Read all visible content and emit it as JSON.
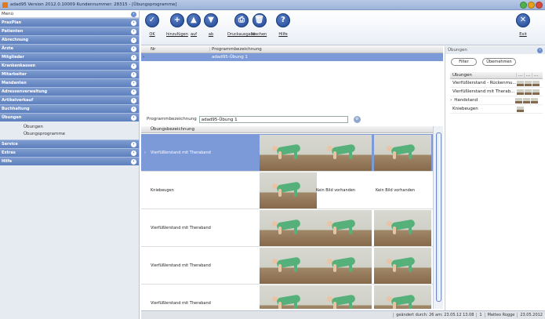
{
  "window": {
    "title": "adad95  Version 2012.0.10009  Kundennummer: 28315 - [Übungsprogramme]",
    "colors": {
      "minimize": "#4fb34a",
      "maximize": "#e3a21a",
      "close": "#d94a3a"
    }
  },
  "sidebar": {
    "header": "Menü",
    "items": [
      {
        "label": "PraxPlan"
      },
      {
        "label": "Patienten"
      },
      {
        "label": "Abrechnung"
      },
      {
        "label": "Ärzte"
      },
      {
        "label": "Mitglieder"
      },
      {
        "label": "Krankenkassen"
      },
      {
        "label": "Mitarbeiter"
      },
      {
        "label": "Mandanten"
      },
      {
        "label": "Adressenverwaltung"
      },
      {
        "label": "Artikelverkauf"
      },
      {
        "label": "Buchhaltung"
      },
      {
        "label": "Übungen"
      }
    ],
    "subitems": [
      "Übungen",
      "Übungsprogramme"
    ],
    "items2": [
      {
        "label": "Service"
      },
      {
        "label": "Extras"
      },
      {
        "label": "Hilfe"
      }
    ]
  },
  "toolbar": [
    {
      "label": "OK",
      "icon": "check-icon",
      "glyph": "✓"
    },
    {
      "label": "hinzufügen",
      "icon": "plus-icon",
      "glyph": "+"
    },
    {
      "label": "auf",
      "icon": "arrow-up-icon",
      "glyph": "▲"
    },
    {
      "label": "ab",
      "icon": "arrow-down-icon",
      "glyph": "▼"
    },
    {
      "label": "Druckausgabe",
      "icon": "printer-icon",
      "glyph": "⎙"
    },
    {
      "label": "löschen",
      "icon": "trash-icon",
      "glyph": "🗑"
    },
    {
      "label": "Hilfe",
      "icon": "help-icon",
      "glyph": "?"
    },
    {
      "label": "Exit",
      "icon": "close-icon",
      "glyph": "✕"
    }
  ],
  "programs": {
    "col_nr": "Nr",
    "col_name": "Programmbezeichnung",
    "rows": [
      {
        "nr": "",
        "name": "adad95-Übung 1",
        "selected": true
      }
    ]
  },
  "program_name": {
    "label": "Programmbezeichnung",
    "value": "adad95-Übung 1"
  },
  "exercises": {
    "col_name": "Übungsbezeichnung",
    "no_image": "Kein Bild vorhanden",
    "rows": [
      {
        "name": "Vierfüßlerstand mit Theraband",
        "images": [
          true,
          true,
          true
        ],
        "selected": true
      },
      {
        "name": "Kniebeugen",
        "images": [
          true,
          false,
          false
        ]
      },
      {
        "name": "Vierfüßlerstand mit Theraband",
        "images": [
          true,
          true,
          true
        ]
      },
      {
        "name": "Vierfüßlerstand mit Theraband",
        "images": [
          true,
          true,
          true
        ]
      },
      {
        "name": "Vierfüßlerstand mit Theraband",
        "images": [
          true,
          true,
          true
        ]
      }
    ]
  },
  "right_panel": {
    "title": "Übungen",
    "filter": "Filter",
    "apply": "Übernehmen",
    "col": "Übungen",
    "col_dots": [
      "...",
      "...",
      "..."
    ],
    "items": [
      {
        "name": "Vierfüßlerstand - Rückenmu...",
        "thumbs": 3
      },
      {
        "name": "Vierfüßlerstand mit Therab...",
        "thumbs": 3
      },
      {
        "name": "Handstand",
        "thumbs": 3,
        "selected": true
      },
      {
        "name": "Kniebeugen",
        "thumbs": 1
      }
    ]
  },
  "status": {
    "changed": "geändert durch: 26 am: 23.05.12 13.08",
    "num": "1",
    "user": "Matteo Rogge",
    "date": "23.05.2012"
  }
}
